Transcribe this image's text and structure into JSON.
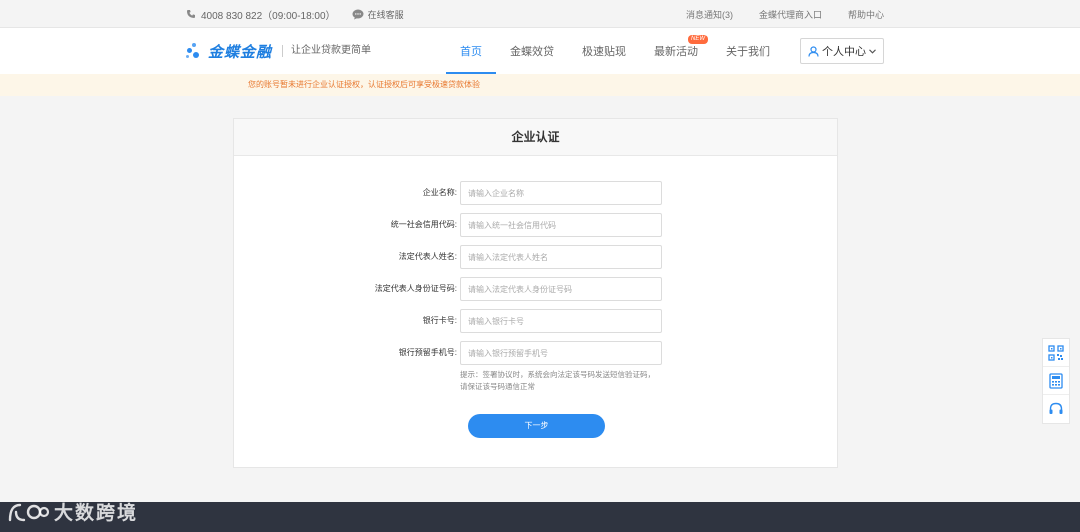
{
  "topbar": {
    "phone": "4008 830 822（09:00-18:00）",
    "service": "在线客服",
    "links": [
      "消息通知(3)",
      "金蝶代理商入口",
      "帮助中心"
    ]
  },
  "header": {
    "logo_text": "金蝶金融",
    "slogan": "让企业贷款更简单",
    "nav": [
      {
        "label": "首页"
      },
      {
        "label": "金蝶效贷"
      },
      {
        "label": "极速贴现"
      },
      {
        "label": "最新活动",
        "badge": "NEW"
      },
      {
        "label": "关于我们"
      }
    ],
    "user_center": "个人中心"
  },
  "notice": "您的账号暂未进行企业认证授权，认证授权后可享受极速贷款体验",
  "form": {
    "title": "企业认证",
    "fields": [
      {
        "label": "企业名称:",
        "placeholder": "请输入企业名称",
        "value": ""
      },
      {
        "label": "统一社会信用代码:",
        "placeholder": "请输入统一社会信用代码",
        "value": ""
      },
      {
        "label": "法定代表人姓名:",
        "placeholder": "请输入法定代表人姓名",
        "value": ""
      },
      {
        "label": "法定代表人身份证号码:",
        "placeholder": "请输入法定代表人身份证号码",
        "value": ""
      },
      {
        "label": "银行卡号:",
        "placeholder": "请输入银行卡号",
        "value": ""
      },
      {
        "label": "银行预留手机号:",
        "placeholder": "请输入银行预留手机号",
        "value": ""
      }
    ],
    "tip": "提示：签署协议时，系统会向法定该号码发送短信验证码，请保证该号码通信正常",
    "next_button": "下一步"
  },
  "watermark": "大数跨境",
  "colors": {
    "accent": "#2d8cf0",
    "notice_text": "#e8772e",
    "footer": "#2f3440"
  }
}
